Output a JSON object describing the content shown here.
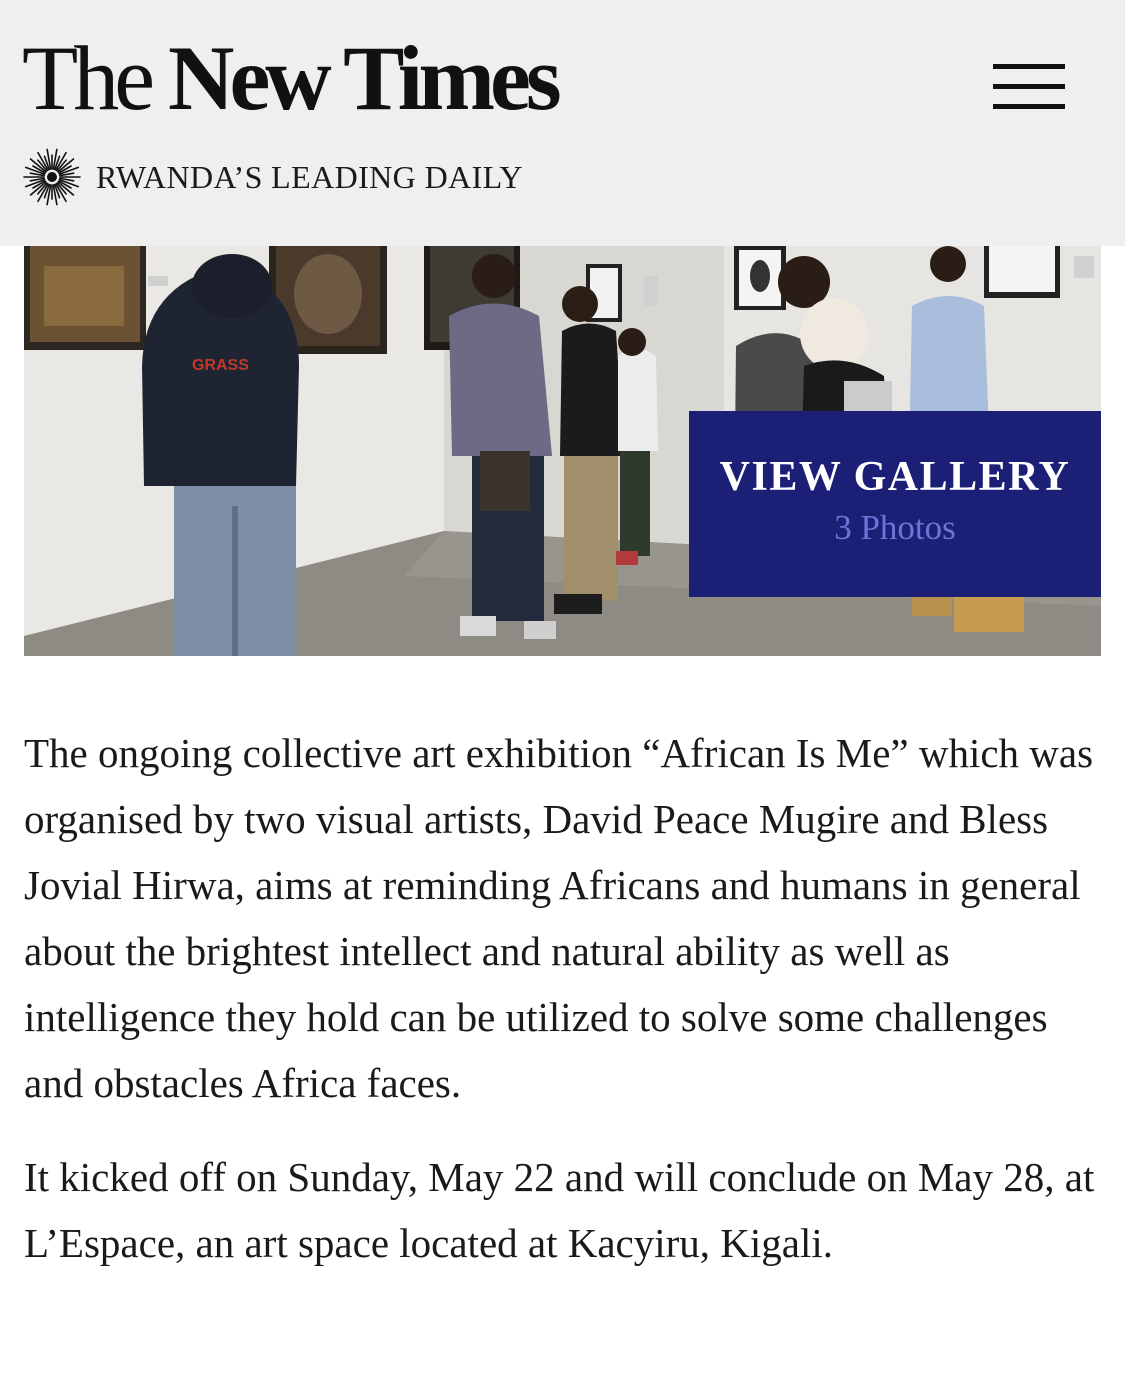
{
  "header": {
    "brand_light": "The ",
    "brand_bold": "New Times",
    "tagline": "RWANDA’S LEADING DAILY",
    "logo_icon": "sunburst-icon",
    "menu_icon": "hamburger-menu-icon"
  },
  "hero": {
    "sweater_text": "GRASS",
    "gallery_label": "VIEW GALLERY",
    "gallery_count": "3 Photos"
  },
  "article": {
    "paragraphs": [
      "The ongoing collective art exhibition “African Is Me” which was organised by two visual artists, David Peace Mugire and Bless Jovial Hirwa, aims at reminding Africans and humans in general about the brightest intellect and natural ability as well as intelligence they hold can be utilized to solve some challenges and obstacles Africa faces.",
      "It kicked off on Sunday, May 22 and will conclude on May 28, at L’Espace, an art space located at Kacyiru, Kigali."
    ]
  },
  "colors": {
    "header_bg": "#efefef",
    "gallery_bg": "#1b1f76",
    "gallery_count": "#6d74d6",
    "text": "#1a1a1a"
  }
}
